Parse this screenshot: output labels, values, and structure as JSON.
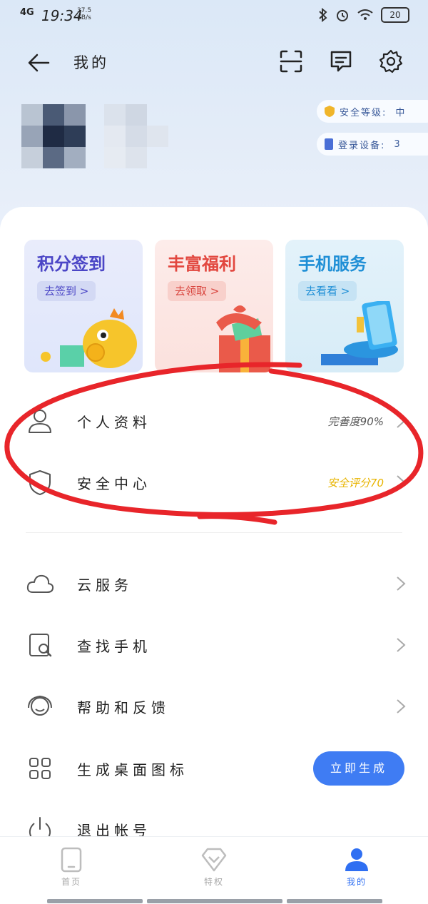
{
  "status_bar": {
    "network": "4G",
    "time": "19:34",
    "speed_value": "37.5",
    "speed_unit": "KB/s",
    "battery": "20"
  },
  "header": {
    "title": "我的",
    "icons": [
      "back-arrow-icon",
      "scan-icon",
      "message-icon",
      "gear-icon"
    ]
  },
  "profile": {
    "security_level_label": "安全等级:",
    "security_level_value": "中",
    "devices_label": "登录设备:",
    "devices_value": "3"
  },
  "promos": [
    {
      "title": "积分签到",
      "button": "去签到 >",
      "color": "#4b46c6"
    },
    {
      "title": "丰富福利",
      "button": "去领取 >",
      "color": "#e2473f"
    },
    {
      "title": "手机服务",
      "button": "去看看 >",
      "color": "#1f8fd6"
    }
  ],
  "menu": {
    "personal": {
      "label": "个人资料",
      "value": "完善度90%"
    },
    "security": {
      "label": "安全中心",
      "value": "安全评分70"
    },
    "cloud": {
      "label": "云服务"
    },
    "find_phone": {
      "label": "查找手机"
    },
    "help": {
      "label": "帮助和反馈"
    },
    "desktop_icon": {
      "label": "生成桌面图标",
      "button": "立即生成"
    },
    "logout": {
      "label": "退出帐号"
    }
  },
  "bottom_nav": {
    "items": [
      {
        "label": "首页",
        "active": false
      },
      {
        "label": "特权",
        "active": false
      },
      {
        "label": "我的",
        "active": true
      }
    ]
  },
  "colors": {
    "accent": "#3f7cf3",
    "security_score": "#e8b400",
    "annotation": "#e8252a"
  }
}
